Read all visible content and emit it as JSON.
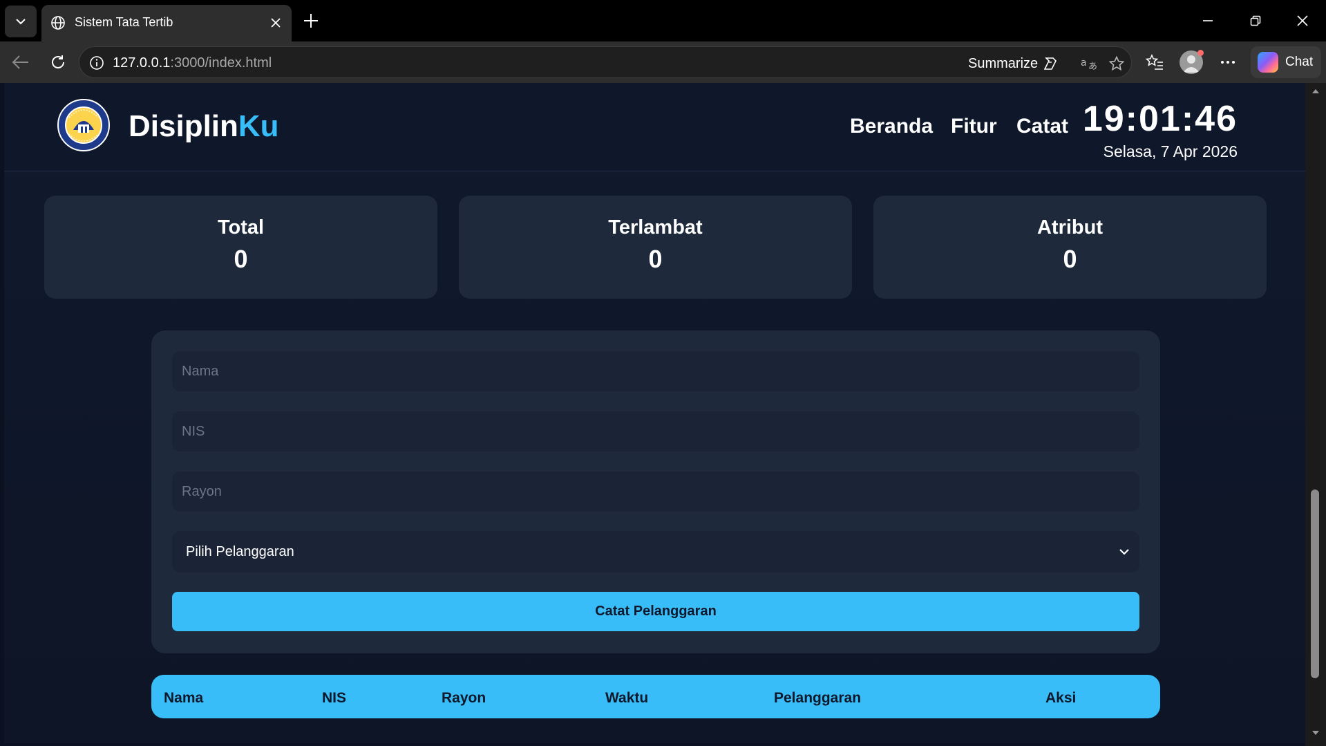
{
  "browser": {
    "tab_title": "Sistem Tata Tertib",
    "url_host": "127.0.0.1",
    "url_rest": ":3000/index.html",
    "summarize_label": "Summarize",
    "chat_label": "Chat"
  },
  "header": {
    "brand_main": "Disiplin",
    "brand_accent": "Ku",
    "nav": [
      "Beranda",
      "Fitur",
      "Catat"
    ],
    "clock": "19:01:46",
    "date": "Selasa, 7 Apr 2026"
  },
  "stats": [
    {
      "label": "Total",
      "value": "0"
    },
    {
      "label": "Terlambat",
      "value": "0"
    },
    {
      "label": "Atribut",
      "value": "0"
    }
  ],
  "form": {
    "nama_placeholder": "Nama",
    "nis_placeholder": "NIS",
    "rayon_placeholder": "Rayon",
    "violation_selected": "Pilih Pelanggaran",
    "submit_label": "Catat Pelanggaran"
  },
  "table": {
    "columns": [
      "Nama",
      "NIS",
      "Rayon",
      "Waktu",
      "Pelanggaran",
      "Aksi"
    ]
  },
  "colors": {
    "accent": "#38bdf8",
    "page_bg": "#0f172a",
    "card_bg": "#1e293b"
  }
}
